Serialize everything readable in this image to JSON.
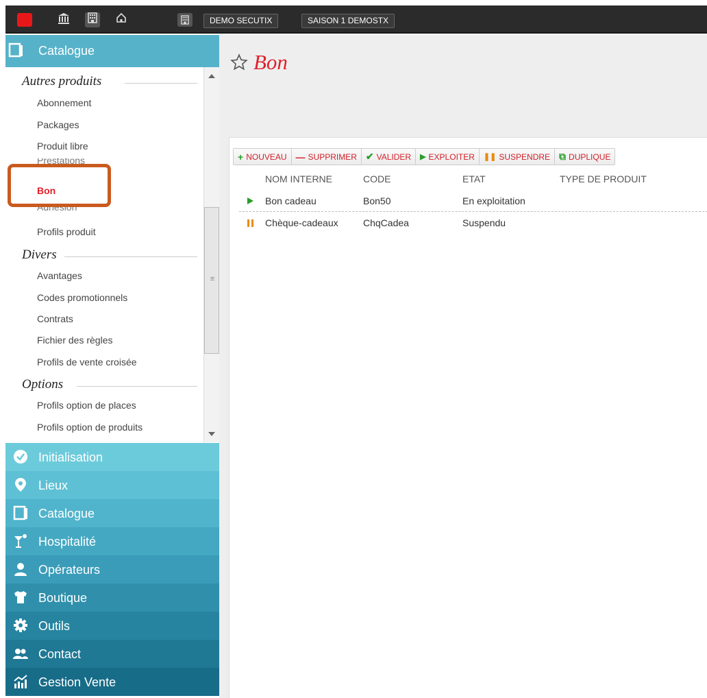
{
  "topbar": {
    "chips": [
      "DEMO SECUTIX",
      "SAISON 1 DEMOSTX"
    ]
  },
  "sidebar": {
    "header": "Catalogue",
    "sections": [
      {
        "title": "Autres produits",
        "items": [
          "Abonnement",
          "Packages",
          "Produit libre",
          "Prestations",
          "Bon",
          "Adhésion",
          "Profils produit"
        ]
      },
      {
        "title": "Divers",
        "items": [
          "Avantages",
          "Codes promotionnels",
          "Contrats",
          "Fichier des règles",
          "Profils de vente croisée"
        ]
      },
      {
        "title": "Options",
        "items": [
          "Profils option de places",
          "Profils option de produits"
        ]
      }
    ],
    "active_item": "Bon",
    "modules": [
      {
        "label": "Initialisation",
        "color": "#6ccbdb"
      },
      {
        "label": "Lieux",
        "color": "#5ec0d4"
      },
      {
        "label": "Catalogue",
        "color": "#50b4cc"
      },
      {
        "label": "Hospitalité",
        "color": "#44a8c2"
      },
      {
        "label": "Opérateurs",
        "color": "#3a9cb8"
      },
      {
        "label": "Boutique",
        "color": "#3090ac"
      },
      {
        "label": "Outils",
        "color": "#2784a0"
      },
      {
        "label": "Contact",
        "color": "#1f7894"
      },
      {
        "label": "Gestion Vente",
        "color": "#176c88"
      }
    ]
  },
  "main": {
    "title": "Bon",
    "toolbar": [
      {
        "label": "NOUVEAU",
        "icon": "+"
      },
      {
        "label": "SUPPRIMER",
        "icon": "—"
      },
      {
        "label": "VALIDER",
        "icon": "✔"
      },
      {
        "label": "EXPLOITER",
        "icon": "▶"
      },
      {
        "label": "SUSPENDRE",
        "icon": "❚❚"
      },
      {
        "label": "DUPLIQUE",
        "icon": "⧉"
      }
    ],
    "columns": [
      "NOM INTERNE",
      "CODE",
      "ETAT",
      "TYPE DE PRODUIT"
    ],
    "rows": [
      {
        "state": "play",
        "name": "Bon cadeau",
        "code": "Bon50",
        "etat": "En exploitation",
        "type": ""
      },
      {
        "state": "pause",
        "name": "Chèque-cadeaux",
        "code": "ChqCadea",
        "etat": "Suspendu",
        "type": ""
      }
    ]
  }
}
